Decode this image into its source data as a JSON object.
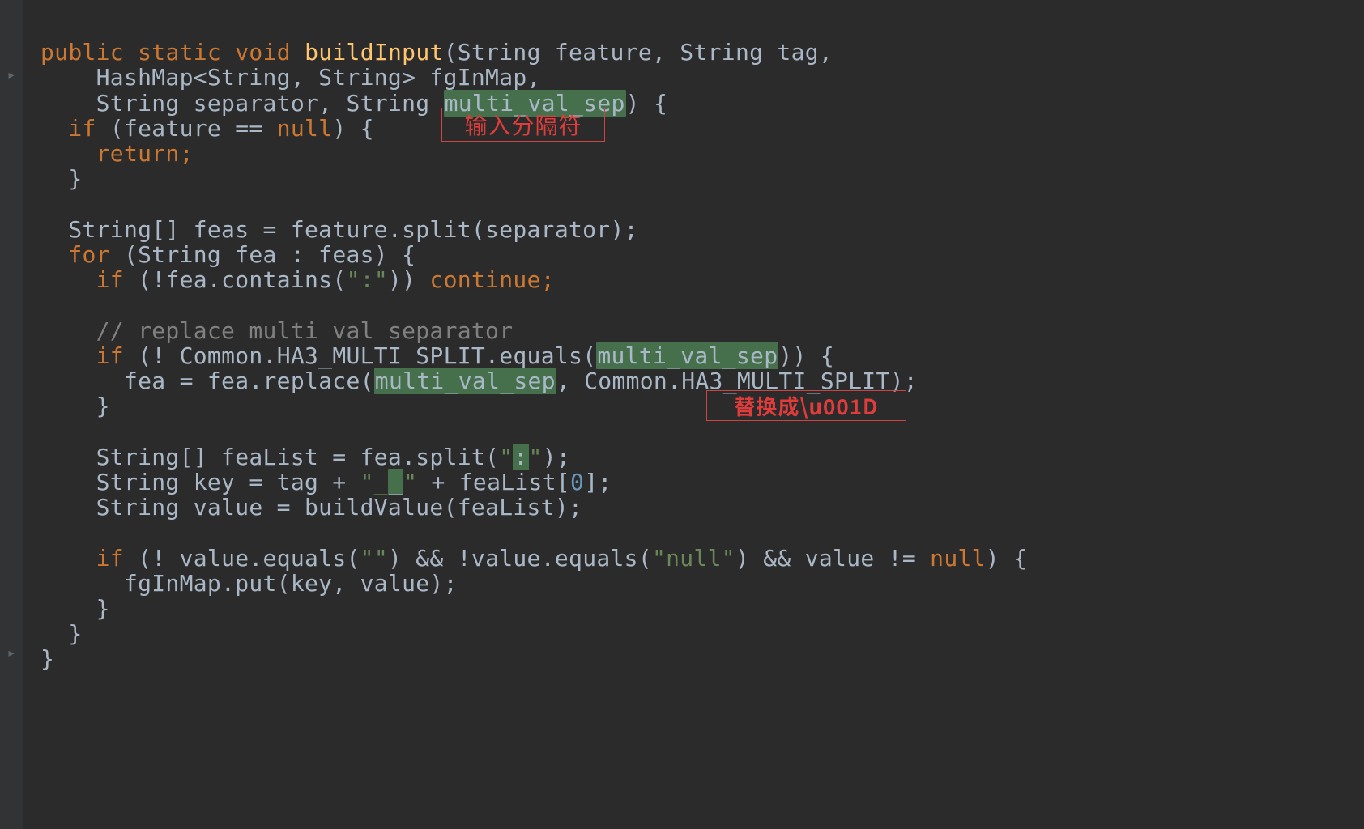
{
  "annotations": {
    "input_separator_label": "输入分隔符",
    "replace_label": "替换成\\u001D"
  },
  "code": {
    "l01_a": "public",
    "l01_b": " ",
    "l01_c": "static",
    "l01_d": " ",
    "l01_e": "void",
    "l01_f": " ",
    "l01_g": "buildInput",
    "l01_h": "(String feature, String tag,",
    "l02": "    HashMap<String, String> fgInMap,",
    "l03_a": "    String separator, String ",
    "l03_b": "multi_val_sep",
    "l03_c": ") {",
    "l04_a": "  ",
    "l04_b": "if",
    "l04_c": " (feature == ",
    "l04_d": "null",
    "l04_e": ") {",
    "l05_a": "    ",
    "l05_b": "return;",
    "l06": "  }",
    "l07": "",
    "l08": "  String[] feas = feature.split(separator);",
    "l09_a": "  ",
    "l09_b": "for",
    "l09_c": " (String fea : feas) {",
    "l10_a": "    ",
    "l10_b": "if",
    "l10_c": " (!fea.contains(",
    "l10_d": "\":\"",
    "l10_e": ")) ",
    "l10_f": "continue;",
    "l11": "",
    "l12_a": "    ",
    "l12_b": "// replace multi val separator",
    "l13_a": "    ",
    "l13_b": "if",
    "l13_c": " (! Common.HA3_MULTI_SPLIT.equals(",
    "l13_d": "multi_val_sep",
    "l13_e": ")) {",
    "l14_a": "      fea = fea.replace(",
    "l14_b": "multi_val_sep",
    "l14_c": ", Common.HA3_MULTI_SPLIT);",
    "l15": "    }",
    "l16": "",
    "l17_a": "    String[] feaList = fea.split(",
    "l17_b": "\"",
    "l17_c": ":",
    "l17_d": "\"",
    "l17_e": ");",
    "l18_a": "    String key = tag + ",
    "l18_b": "\"_",
    "l18_c": "_",
    "l18_d": "\"",
    "l18_e": " + feaList[",
    "l18_f": "0",
    "l18_g": "];",
    "l19": "    String value = buildValue(feaList);",
    "l20": "",
    "l21_a": "    ",
    "l21_b": "if",
    "l21_c": " (! value.equals(",
    "l21_d": "\"\"",
    "l21_e": ") && !value.equals(",
    "l21_f": "\"null\"",
    "l21_g": ") && value != ",
    "l21_h": "null",
    "l21_i": ") {",
    "l22": "      fgInMap.put(key, value);",
    "l23": "    }",
    "l24": "  }",
    "l25": "}"
  }
}
